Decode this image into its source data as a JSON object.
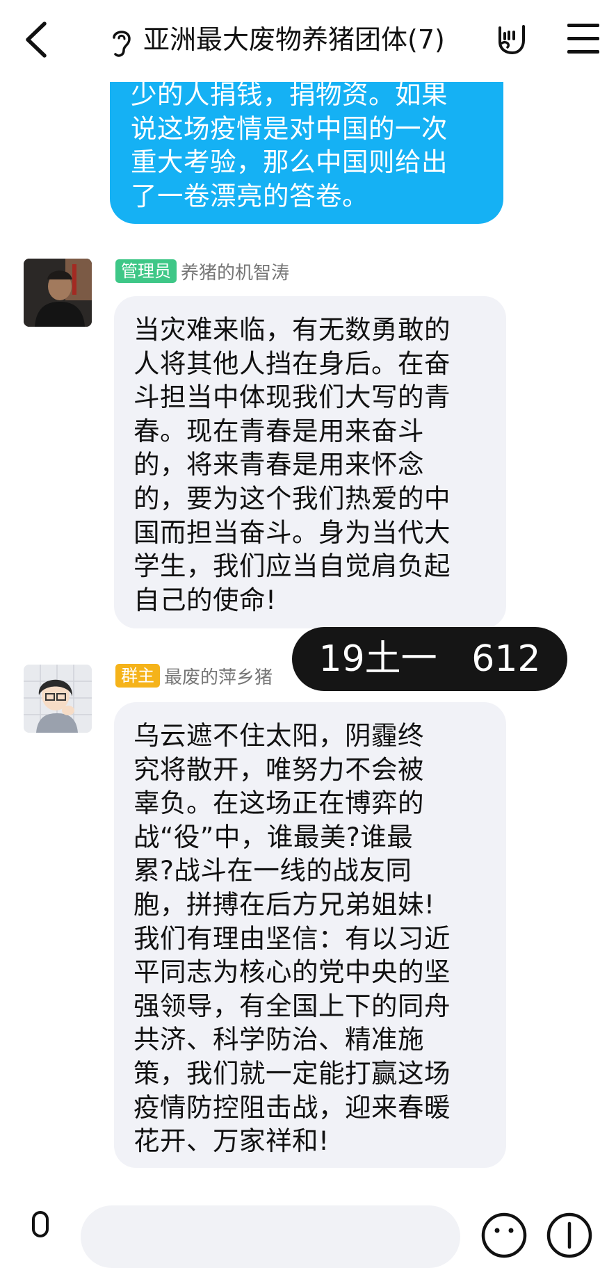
{
  "header": {
    "title": "亚洲最大废物养猪团体(7)"
  },
  "messages": {
    "self_partial": {
      "text": "少的人捐钱，捐物资。如果\n说这场疫情是对中国的一次\n重大考验，那么中国则给出\n了一卷漂亮的答卷。"
    },
    "msg1": {
      "role_badge": "管理员",
      "sender": "养猪的机智涛",
      "text": "当灾难来临，有无数勇敢的\n人将其他人挡在身后。在奋\n斗担当中体现我们大写的青\n春。现在青春是用来奋斗\n的，将来青春是用来怀念\n的，要为这个我们热爱的中\n国而担当奋斗。身为当代大\n学生，我们应当自觉肩负起\n自己的使命!"
    },
    "msg2": {
      "role_badge": "群主",
      "sender": "最废的萍乡猪",
      "text": "乌云遮不住太阳，阴霾终\n究将散开，唯努力不会被\n辜负。在这场正在博弈的\n战“役”中，谁最美?谁最\n累?战斗在一线的战友同\n胞，拼搏在后方兄弟姐妹!\n我们有理由坚信：有以习近\n平同志为核心的党中央的坚\n强领导，有全国上下的同舟\n共济、科学防治、精准施\n策，我们就一定能打赢这场\n疫情防控阻击战，迎来春暖\n花开、万家祥和!"
    }
  },
  "overlay": {
    "text": "19土一   612"
  },
  "input": {
    "value": ""
  },
  "colors": {
    "self_bubble": "#15b1f4",
    "other_bubble": "#f1f2f7",
    "admin_badge": "#3ec787",
    "owner_badge": "#f5b31a"
  }
}
